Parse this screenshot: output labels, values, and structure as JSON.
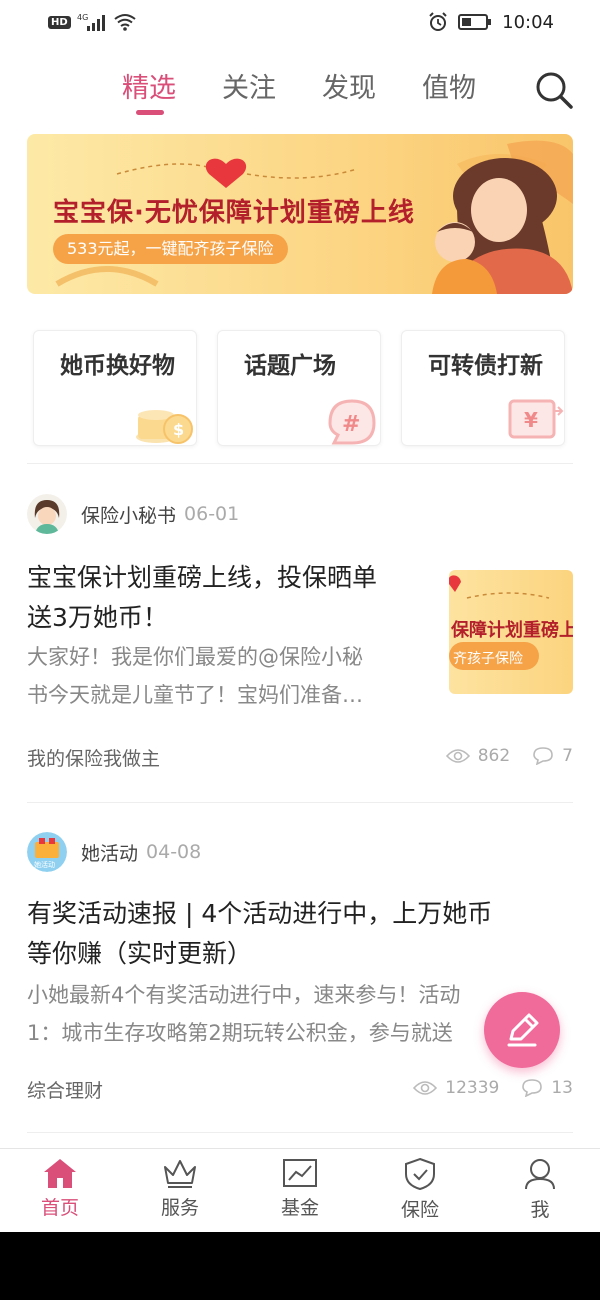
{
  "status_bar": {
    "network": "4G",
    "hd": "HD",
    "time": "10:04"
  },
  "top_tabs": [
    "精选",
    "关注",
    "发现",
    "值物"
  ],
  "banner": {
    "title": "宝宝保·无忧保障计划重磅上线",
    "subtitle": "533元起，一键配齐孩子保险"
  },
  "quick_entries": [
    {
      "label": "她币换好物",
      "icon": "coin-icon"
    },
    {
      "label": "话题广场",
      "icon": "hashtag-icon"
    },
    {
      "label": "可转债打新",
      "icon": "yen-swap-icon"
    }
  ],
  "posts": [
    {
      "author": "保险小秘书",
      "date": "06-01",
      "title_lines": [
        "宝宝保计划重磅上线，投保晒单",
        "送3万她币！"
      ],
      "excerpt_lines": [
        "大家好！我是你们最爱的@保险小秘",
        "书今天就是儿童节了！宝妈们准备…"
      ],
      "tag": "我的保险我做主",
      "views": "862",
      "comments": "7",
      "thumb_title": "保障计划重磅上",
      "thumb_sub": "齐孩子保险"
    },
    {
      "author": "她活动",
      "date": "04-08",
      "title_lines": [
        "有奖活动速报 | 4个活动进行中，上万她币",
        "等你赚（实时更新）"
      ],
      "excerpt_lines": [
        "小她最新4个有奖活动进行中，速来参与！活动",
        "1：城市生存攻略第2期玩转公积金，参与就送"
      ],
      "tag": "综合理财",
      "views": "12339",
      "comments": "13",
      "avatar_caption": "她活动"
    }
  ],
  "bottom_nav": [
    "首页",
    "服务",
    "基金",
    "保险",
    "我"
  ],
  "colors": {
    "accent": "#d94f7a",
    "fab": "#f06a9a",
    "banner_title": "#b3202c"
  }
}
